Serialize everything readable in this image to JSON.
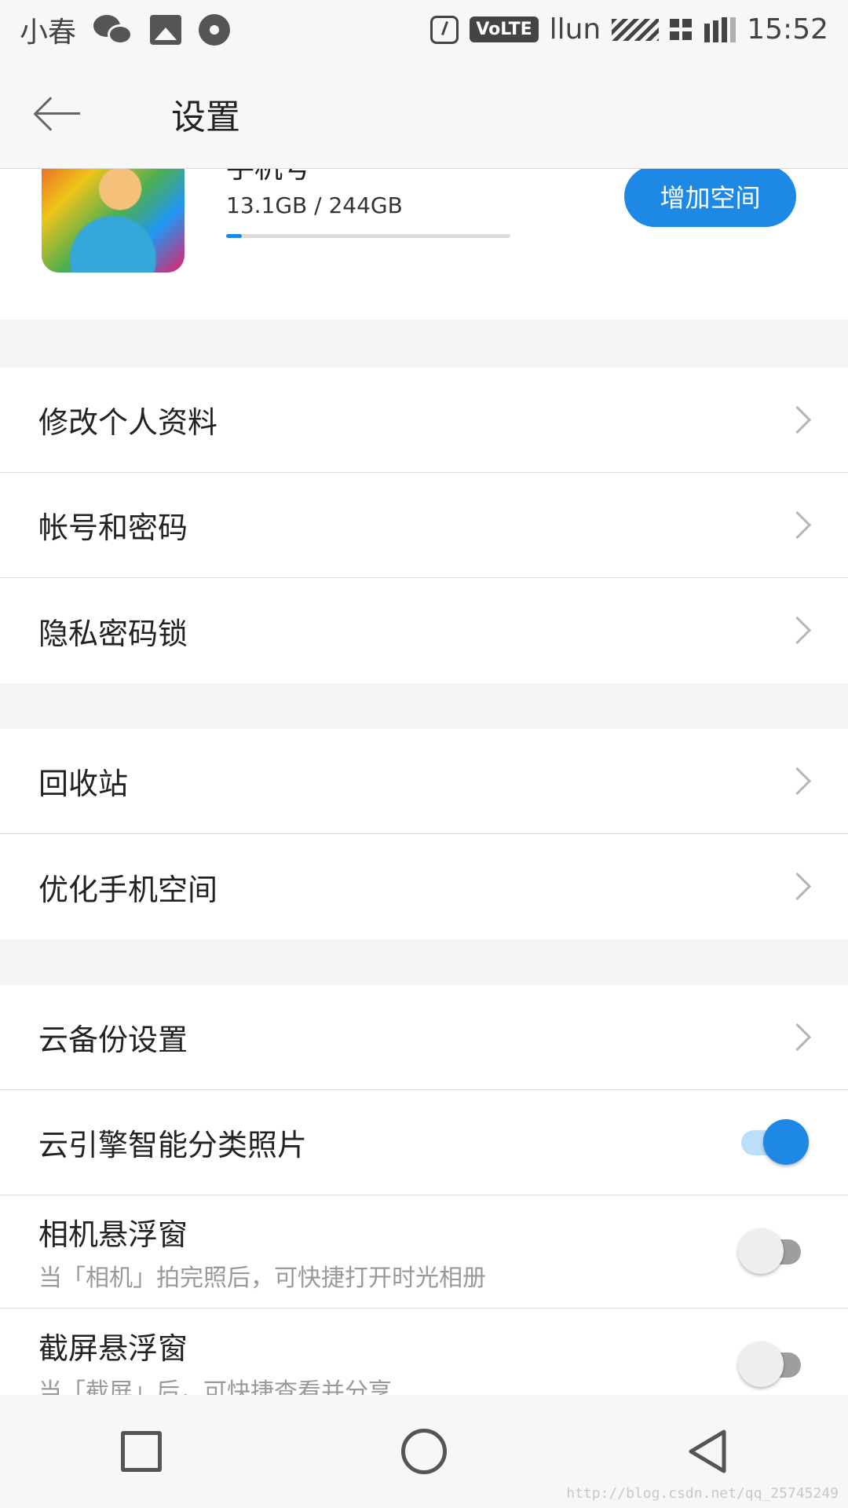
{
  "status_bar": {
    "app_name": "小春",
    "volte": "VoLTE",
    "carrier": "llun",
    "time": "15:52",
    "icons": [
      "wechat-icon",
      "gallery-icon",
      "music-icon",
      "clock-icon",
      "signal-icon",
      "wifi-icon",
      "battery-icon"
    ]
  },
  "header": {
    "title": "设置"
  },
  "profile": {
    "name": "手机号",
    "storage": "13.1GB / 244GB",
    "usage_fraction": 0.054,
    "add_space_label": "增加空间"
  },
  "section1": {
    "items": [
      {
        "label": "修改个人资料"
      },
      {
        "label": "帐号和密码"
      },
      {
        "label": "隐私密码锁"
      }
    ]
  },
  "section2": {
    "items": [
      {
        "label": "回收站"
      },
      {
        "label": "优化手机空间"
      }
    ]
  },
  "section3": {
    "cloud_backup": {
      "label": "云备份设置"
    },
    "smart_classify": {
      "label": "云引擎智能分类照片",
      "enabled": true
    },
    "camera_float": {
      "label": "相机悬浮窗",
      "desc": "当「相机」拍完照后，可快捷打开时光相册",
      "enabled": false
    },
    "screenshot_float": {
      "label": "截屏悬浮窗",
      "desc": "当「截屏」后，可快捷查看并分享",
      "enabled": false
    }
  },
  "watermark": "http://blog.csdn.net/qq_25745249",
  "colors": {
    "accent": "#1e88e5",
    "background": "#f5f5f5"
  }
}
